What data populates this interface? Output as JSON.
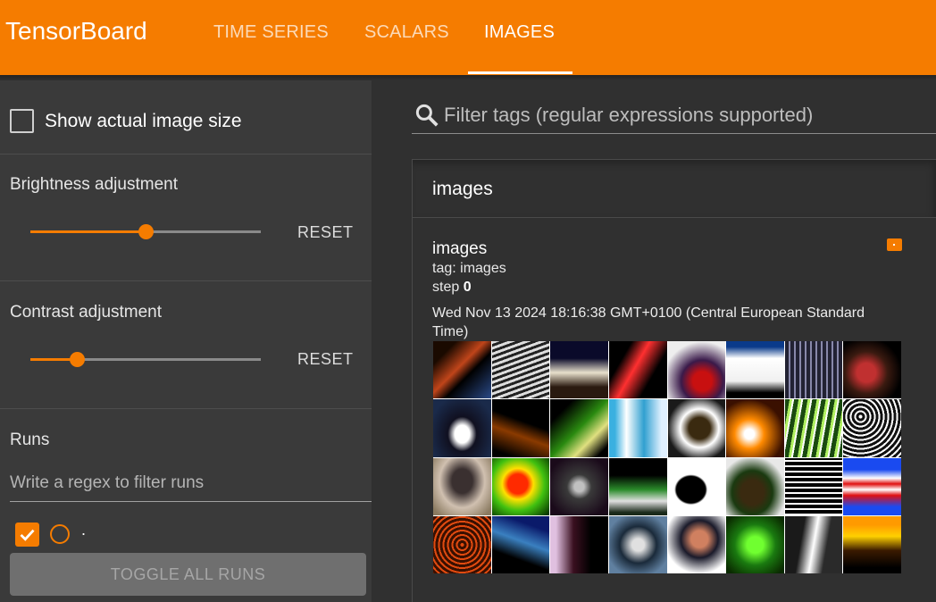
{
  "app": {
    "title": "TensorBoard",
    "tabs": [
      {
        "label": "TIME SERIES",
        "active": false
      },
      {
        "label": "SCALARS",
        "active": false
      },
      {
        "label": "IMAGES",
        "active": true
      }
    ],
    "accent_color": "#f57c00"
  },
  "sidebar": {
    "show_actual_size": {
      "label": "Show actual image size",
      "checked": false
    },
    "brightness": {
      "title": "Brightness adjustment",
      "value_fraction": 0.5,
      "reset_label": "RESET"
    },
    "contrast": {
      "title": "Contrast adjustment",
      "value_fraction": 0.2,
      "reset_label": "RESET"
    },
    "runs": {
      "title": "Runs",
      "filter_placeholder": "Write a regex to filter runs",
      "items": [
        {
          "name": ".",
          "checked": true
        }
      ],
      "toggle_label": "TOGGLE ALL RUNS"
    }
  },
  "main": {
    "filter_placeholder": "Filter tags (regular expressions supported)",
    "search_icon": "search-icon",
    "group": {
      "title": "images",
      "card": {
        "title": "images",
        "tag_line": "tag: images",
        "step_label": "step ",
        "step_value": "0",
        "timestamp": "Wed Nov 13 2024 18:16:38 GMT+0100 (Central European Standard Time)"
      }
    }
  },
  "image_tiles": [
    {
      "bg": "linear-gradient(135deg,#1a0a00 20%,#c0451a 45%,#000 60%,#2a4a88 100%)"
    },
    {
      "bg": "repeating-linear-gradient(160deg,#ddd 0 3px,#222 3px 6px)"
    },
    {
      "bg": "linear-gradient(180deg,#0a0a2a 30%,#e8e0cc 55%,#2a1a10 80%)"
    },
    {
      "bg": "linear-gradient(120deg,#000 25%,#ff3030 45%,#000 70%)"
    },
    {
      "bg": "radial-gradient(circle at 60% 70%,#c81010 18%,#3a1a4a 40%,#eee 75%)"
    },
    {
      "bg": "linear-gradient(180deg,#0a3a8a 10%,#fff 30%,#f0f0f0 70%,#000 90%)"
    },
    {
      "bg": "repeating-linear-gradient(90deg,#223 0 4px,#88a 4px 6px),radial-gradient(circle at 50% 30%,#e00 20%,transparent 30%)"
    },
    {
      "bg": "radial-gradient(circle at 40% 55%,#c03030 20%,#3a1a10 45%,#000 75%)"
    },
    {
      "bg": "radial-gradient(ellipse at 50% 60%,#fff 18%,#101020 35%,#1a2a4a 80%)"
    },
    {
      "bg": "linear-gradient(200deg,#000 40%,#8a3a00 60%,#000 90%)"
    },
    {
      "bg": "linear-gradient(135deg,#000 20%,#2a8a10 50%,#e0e080 70%,#000 90%)"
    },
    {
      "bg": "linear-gradient(90deg,#3ab0e0 10%,#fff 30%,#30a0d0 60%,#e0f0ff 90%)"
    },
    {
      "bg": "radial-gradient(circle at 55% 50%,#3a2a10 25%,#fff 45%,#1a1a1a 75%)"
    },
    {
      "bg": "radial-gradient(circle at 40% 60%,#fff 10%,#ff8a00 30%,#3a1000 70%)"
    },
    {
      "bg": "repeating-linear-gradient(100deg,#1a4a10 0 5px,#b0f060 5px 8px,#fff 8px 10px)"
    },
    {
      "bg": "repeating-radial-gradient(circle at 30% 30%,#fff 0 2px,#111 2px 5px)"
    },
    {
      "bg": "radial-gradient(ellipse at 50% 40%,#3a3030 25%,#d0c0b0 55%,#8a7a60 90%)"
    },
    {
      "bg": "radial-gradient(circle at 45% 45%,#ff2a00 22%,#ffe000 35%,#40c010 60%,#0a3a00 95%)"
    },
    {
      "bg": "radial-gradient(circle at 50% 50%,#c0c0c0 12%,#3a3a3a 30%,#1a0a1a 80%)"
    },
    {
      "bg": "linear-gradient(180deg,#000 30%,#2a8a2a 55%,#e0e0e0 75%,#1a2a1a 95%)"
    },
    {
      "bg": "radial-gradient(ellipse at 40% 55%,#000 30%,#fff 34%)"
    },
    {
      "bg": "radial-gradient(ellipse at 45% 60%,#3a2a10 25%,#1a3a10 45%,#e8e8e8 75%)"
    },
    {
      "bg": "repeating-linear-gradient(0deg,#fff 0 2px,#000 2px 6px),repeating-linear-gradient(90deg,#fff 0 2px,transparent 2px 6px)"
    },
    {
      "bg": "linear-gradient(180deg,#1a4af0 20%,#fff 35%,#e01010 45%,#fff 55%,#e01010 65%,#1a4af0 85%)"
    },
    {
      "bg": "repeating-radial-gradient(circle at 50% 50%,#e04a10 0 2px,#3a1000 2px 5px)"
    },
    {
      "bg": "linear-gradient(200deg,#0a1a6a 20%,#3a80c0 45%,#000 70%)"
    },
    {
      "bg": "linear-gradient(90deg,#e0c0e0 10%,#3a1020 40%,#000 70%)"
    },
    {
      "bg": "radial-gradient(circle at 50% 50%,#e0e0e0 15%,#1a2a3a 45%,#6080a0 80%)"
    },
    {
      "bg": "radial-gradient(circle at 55% 40%,#d08060 18%,#1a1a2a 40%,#fff 75%)"
    },
    {
      "bg": "radial-gradient(circle at 50% 50%,#70ff30 20%,#1a7a10 50%,#0a2a00 90%)"
    },
    {
      "bg": "linear-gradient(100deg,#1a1a1a 30%,#fff 50%,#2a2a2a 70%)"
    },
    {
      "bg": "linear-gradient(180deg,#ff9a00 15%,#ffd000 35%,#3a1a00 60%,#000 90%)"
    }
  ]
}
